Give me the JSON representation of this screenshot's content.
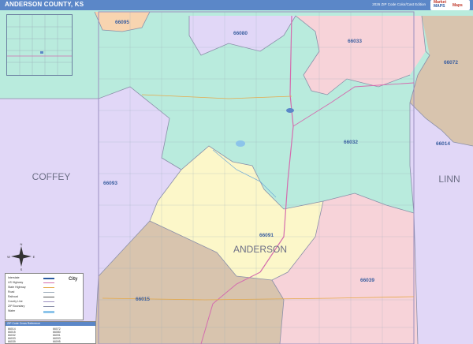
{
  "header": {
    "title": "ANDERSON COUNTY, KS",
    "edition": "2026 ZIP Code Color/Cast Edition",
    "brand_lines": [
      "Market",
      "MAPS",
      "Maps"
    ]
  },
  "counties": {
    "center": "ANDERSON",
    "west": "COFFEY",
    "east": "LINN"
  },
  "zip_labels": {
    "z66095": "66095",
    "z66080": "66080",
    "z66033": "66033",
    "z66072": "66072",
    "z66032": "66032",
    "z66014": "66014",
    "z66093": "66093",
    "z66091": "66091",
    "z66039": "66039",
    "z66015": "66015"
  },
  "colors": {
    "teal": "#b9ebdd",
    "lavender": "#e1d7f7",
    "pink": "#f7d3d9",
    "tan": "#d8c4ae",
    "yellow": "#fcf7c9",
    "orange": "#f8d4b0",
    "header": "#5b87c8",
    "road": "#d46cae",
    "boundary": "#8a8fa8"
  },
  "legend": {
    "rows": [
      "Interstate",
      "US Highway",
      "State Highway",
      "Road",
      "Railroad",
      "County Line",
      "ZIP Boundary",
      "Water"
    ],
    "city_sample": "City"
  },
  "zip_table": {
    "header": "ZIP Code Cross Reference",
    "cells": [
      "66014",
      "66015",
      "66032",
      "66033",
      "66039",
      "66072",
      "66080",
      "66091",
      "66093",
      "66095"
    ]
  },
  "compass": {
    "n": "N",
    "s": "S",
    "e": "E",
    "w": "W"
  }
}
